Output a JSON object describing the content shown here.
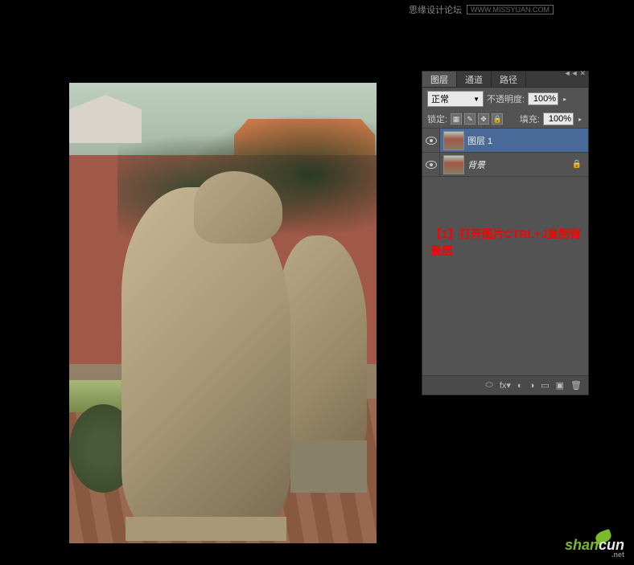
{
  "top_watermark": {
    "text": "思缘设计论坛",
    "url": "WWW.MISSYUAN.COM"
  },
  "panel": {
    "tabs": {
      "layers": "图层",
      "channels": "通道",
      "paths": "路径"
    },
    "blend_mode": "正常",
    "opacity_label": "不透明度:",
    "opacity_value": "100%",
    "lock_label": "锁定:",
    "fill_label": "填充:",
    "fill_value": "100%",
    "layers": [
      {
        "name": "图层 1",
        "selected": true,
        "locked": false
      },
      {
        "name": "背景",
        "selected": false,
        "locked": true,
        "italic": true
      }
    ],
    "collapse": "◄◄",
    "close": "✕"
  },
  "annotation": "【1】打开图片CTRL+J复制背景层",
  "bottom_watermark": {
    "brand_g": "shan",
    "brand_w": "cun",
    "sub": ".net"
  }
}
